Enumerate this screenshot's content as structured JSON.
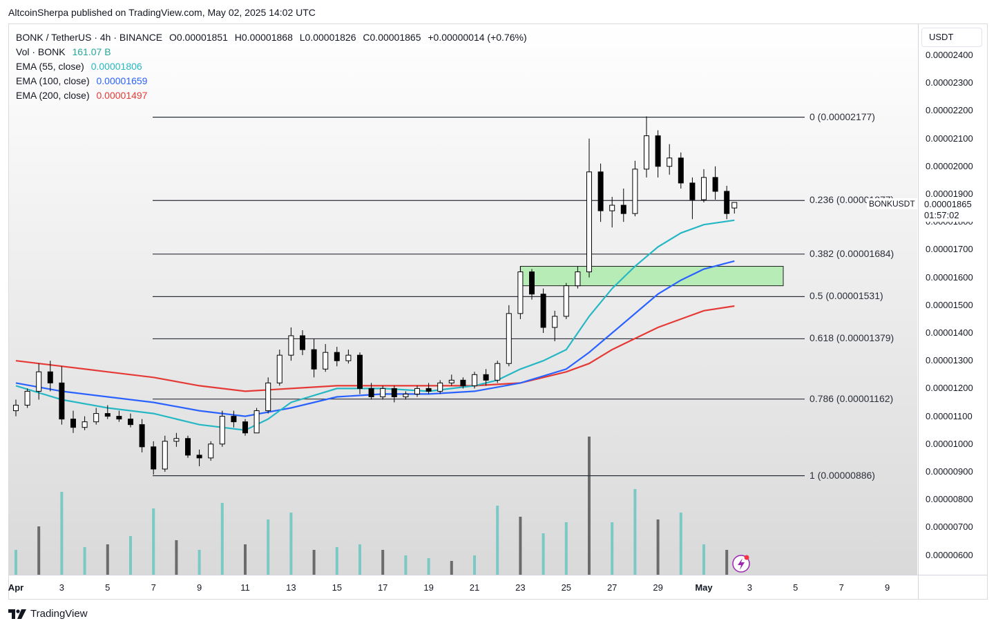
{
  "header": {
    "publisher_text": "AltcoinSherpa published on TradingView.com, May 02, 2025 14:02 UTC"
  },
  "legend": {
    "symbol_line": "BONK / TetherUS · 4h · BINANCE",
    "ohlc": {
      "open": "O0.00001851",
      "high": "H0.00001868",
      "low": "L0.00001826",
      "close": "C0.00001865",
      "change": "+0.00000014 (+0.76%)"
    },
    "vol_label": "Vol · BONK",
    "vol_value": "161.07 B",
    "ema55_label": "EMA (55, close)",
    "ema55_value": "0.00001806",
    "ema100_label": "EMA (100, close)",
    "ema100_value": "0.00001659",
    "ema200_label": "EMA (200, close)",
    "ema200_value": "0.00001497"
  },
  "currency_button": "USDT",
  "price_axis_labels": [
    "0.00002400",
    "0.00002300",
    "0.00002200",
    "0.00002100",
    "0.00002000",
    "0.00001900",
    "0.00001800",
    "0.00001700",
    "0.00001600",
    "0.00001500",
    "0.00001400",
    "0.00001300",
    "0.00001200",
    "0.00001100",
    "0.00001000",
    "0.00000900",
    "0.00000800",
    "0.00000700",
    "0.00000600"
  ],
  "time_axis_labels": [
    "Apr",
    "3",
    "5",
    "7",
    "9",
    "11",
    "13",
    "15",
    "17",
    "19",
    "21",
    "23",
    "25",
    "27",
    "29",
    "May",
    "3",
    "5",
    "7",
    "9"
  ],
  "current_price": {
    "symbol": "BONKUSDT",
    "price": "0.00001865",
    "countdown": "01:57:02"
  },
  "fib_levels": [
    {
      "label": "0 (0.00002177)",
      "price": 2.177e-05
    },
    {
      "label": "0.236 (0.00001877)",
      "price": 1.877e-05
    },
    {
      "label": "0.382 (0.00001684)",
      "price": 1.684e-05
    },
    {
      "label": "0.5 (0.00001531)",
      "price": 1.531e-05
    },
    {
      "label": "0.618 (0.00001379)",
      "price": 1.379e-05
    },
    {
      "label": "0.786 (0.00001162)",
      "price": 1.162e-05
    },
    {
      "label": "1 (0.00000886)",
      "price": 8.86e-06
    }
  ],
  "footer": {
    "brand": "TradingView"
  },
  "colors": {
    "ema55": "#26b7c5",
    "ema100": "#2962ff",
    "ema200": "#e53935",
    "zone_fill": "#b7ecb7",
    "vol_up": "#7ac9c5",
    "vol_down": "#6b6b6b",
    "candle_up": "#ffffff",
    "candle_down": "#000000"
  },
  "chart_data": {
    "type": "candlestick",
    "symbol": "BONKUSDT",
    "interval": "4h",
    "y_range": [
      5.5e-06,
      2.45e-05
    ],
    "x_start": "2025-04-01",
    "x_end": "2025-05-09",
    "support_zone": {
      "from": "2025-04-23",
      "to": "2025-05-04",
      "low": 1.57e-05,
      "high": 1.64e-05
    },
    "candles": [
      {
        "t": "2025-04-01T00",
        "o": 1.12e-05,
        "h": 1.16e-05,
        "l": 1.1e-05,
        "c": 1.14e-05
      },
      {
        "t": "2025-04-01T12",
        "o": 1.14e-05,
        "h": 1.2e-05,
        "l": 1.13e-05,
        "c": 1.19e-05
      },
      {
        "t": "2025-04-02T00",
        "o": 1.19e-05,
        "h": 1.29e-05,
        "l": 1.16e-05,
        "c": 1.26e-05
      },
      {
        "t": "2025-04-02T12",
        "o": 1.26e-05,
        "h": 1.3e-05,
        "l": 1.19e-05,
        "c": 1.22e-05
      },
      {
        "t": "2025-04-03T00",
        "o": 1.22e-05,
        "h": 1.28e-05,
        "l": 1.07e-05,
        "c": 1.09e-05
      },
      {
        "t": "2025-04-03T12",
        "o": 1.09e-05,
        "h": 1.12e-05,
        "l": 1.04e-05,
        "c": 1.06e-05
      },
      {
        "t": "2025-04-04T00",
        "o": 1.06e-05,
        "h": 1.1e-05,
        "l": 1.05e-05,
        "c": 1.08e-05
      },
      {
        "t": "2025-04-04T12",
        "o": 1.08e-05,
        "h": 1.13e-05,
        "l": 1.07e-05,
        "c": 1.11e-05
      },
      {
        "t": "2025-04-05T00",
        "o": 1.11e-05,
        "h": 1.14e-05,
        "l": 1.09e-05,
        "c": 1.1e-05
      },
      {
        "t": "2025-04-05T12",
        "o": 1.1e-05,
        "h": 1.12e-05,
        "l": 1.08e-05,
        "c": 1.09e-05
      },
      {
        "t": "2025-04-06T00",
        "o": 1.09e-05,
        "h": 1.11e-05,
        "l": 1.06e-05,
        "c": 1.07e-05
      },
      {
        "t": "2025-04-06T12",
        "o": 1.07e-05,
        "h": 1.09e-05,
        "l": 9.7e-06,
        "c": 9.9e-06
      },
      {
        "t": "2025-04-07T00",
        "o": 9.9e-06,
        "h": 1.01e-05,
        "l": 8.9e-06,
        "c": 9.1e-06
      },
      {
        "t": "2025-04-07T12",
        "o": 9.1e-06,
        "h": 1.03e-05,
        "l": 9e-06,
        "c": 1.01e-05
      },
      {
        "t": "2025-04-08T00",
        "o": 1.01e-05,
        "h": 1.04e-05,
        "l": 9.9e-06,
        "c": 1.02e-05
      },
      {
        "t": "2025-04-08T12",
        "o": 1.02e-05,
        "h": 1.03e-05,
        "l": 9.5e-06,
        "c": 9.6e-06
      },
      {
        "t": "2025-04-09T00",
        "o": 9.6e-06,
        "h": 9.8e-06,
        "l": 9.2e-06,
        "c": 9.5e-06
      },
      {
        "t": "2025-04-09T12",
        "o": 9.5e-06,
        "h": 1.01e-05,
        "l": 9.4e-06,
        "c": 1e-05
      },
      {
        "t": "2025-04-10T00",
        "o": 1e-05,
        "h": 1.12e-05,
        "l": 9.9e-06,
        "c": 1.1e-05
      },
      {
        "t": "2025-04-10T12",
        "o": 1.1e-05,
        "h": 1.12e-05,
        "l": 1.06e-05,
        "c": 1.08e-05
      },
      {
        "t": "2025-04-11T00",
        "o": 1.08e-05,
        "h": 1.09e-05,
        "l": 1.03e-05,
        "c": 1.04e-05
      },
      {
        "t": "2025-04-11T12",
        "o": 1.04e-05,
        "h": 1.13e-05,
        "l": 1.04e-05,
        "c": 1.12e-05
      },
      {
        "t": "2025-04-12T00",
        "o": 1.12e-05,
        "h": 1.24e-05,
        "l": 1.11e-05,
        "c": 1.22e-05
      },
      {
        "t": "2025-04-12T12",
        "o": 1.22e-05,
        "h": 1.34e-05,
        "l": 1.21e-05,
        "c": 1.32e-05
      },
      {
        "t": "2025-04-13T00",
        "o": 1.32e-05,
        "h": 1.42e-05,
        "l": 1.3e-05,
        "c": 1.39e-05
      },
      {
        "t": "2025-04-13T12",
        "o": 1.39e-05,
        "h": 1.41e-05,
        "l": 1.32e-05,
        "c": 1.34e-05
      },
      {
        "t": "2025-04-14T00",
        "o": 1.34e-05,
        "h": 1.38e-05,
        "l": 1.24e-05,
        "c": 1.27e-05
      },
      {
        "t": "2025-04-14T12",
        "o": 1.27e-05,
        "h": 1.36e-05,
        "l": 1.26e-05,
        "c": 1.33e-05
      },
      {
        "t": "2025-04-15T00",
        "o": 1.33e-05,
        "h": 1.35e-05,
        "l": 1.28e-05,
        "c": 1.3e-05
      },
      {
        "t": "2025-04-15T12",
        "o": 1.3e-05,
        "h": 1.34e-05,
        "l": 1.29e-05,
        "c": 1.32e-05
      },
      {
        "t": "2025-04-16T00",
        "o": 1.32e-05,
        "h": 1.33e-05,
        "l": 1.18e-05,
        "c": 1.2e-05
      },
      {
        "t": "2025-04-16T12",
        "o": 1.2e-05,
        "h": 1.22e-05,
        "l": 1.16e-05,
        "c": 1.17e-05
      },
      {
        "t": "2025-04-17T00",
        "o": 1.17e-05,
        "h": 1.21e-05,
        "l": 1.16e-05,
        "c": 1.2e-05
      },
      {
        "t": "2025-04-17T12",
        "o": 1.2e-05,
        "h": 1.21e-05,
        "l": 1.15e-05,
        "c": 1.17e-05
      },
      {
        "t": "2025-04-18T00",
        "o": 1.17e-05,
        "h": 1.19e-05,
        "l": 1.16e-05,
        "c": 1.18e-05
      },
      {
        "t": "2025-04-18T12",
        "o": 1.18e-05,
        "h": 1.21e-05,
        "l": 1.17e-05,
        "c": 1.2e-05
      },
      {
        "t": "2025-04-19T00",
        "o": 1.2e-05,
        "h": 1.22e-05,
        "l": 1.18e-05,
        "c": 1.19e-05
      },
      {
        "t": "2025-04-19T12",
        "o": 1.19e-05,
        "h": 1.23e-05,
        "l": 1.18e-05,
        "c": 1.22e-05
      },
      {
        "t": "2025-04-20T00",
        "o": 1.22e-05,
        "h": 1.25e-05,
        "l": 1.21e-05,
        "c": 1.23e-05
      },
      {
        "t": "2025-04-20T12",
        "o": 1.23e-05,
        "h": 1.24e-05,
        "l": 1.2e-05,
        "c": 1.21e-05
      },
      {
        "t": "2025-04-21T00",
        "o": 1.21e-05,
        "h": 1.26e-05,
        "l": 1.2e-05,
        "c": 1.25e-05
      },
      {
        "t": "2025-04-21T12",
        "o": 1.25e-05,
        "h": 1.27e-05,
        "l": 1.21e-05,
        "c": 1.23e-05
      },
      {
        "t": "2025-04-22T00",
        "o": 1.23e-05,
        "h": 1.3e-05,
        "l": 1.22e-05,
        "c": 1.29e-05
      },
      {
        "t": "2025-04-22T12",
        "o": 1.29e-05,
        "h": 1.5e-05,
        "l": 1.28e-05,
        "c": 1.47e-05
      },
      {
        "t": "2025-04-23T00",
        "o": 1.47e-05,
        "h": 1.64e-05,
        "l": 1.45e-05,
        "c": 1.62e-05
      },
      {
        "t": "2025-04-23T12",
        "o": 1.62e-05,
        "h": 1.63e-05,
        "l": 1.52e-05,
        "c": 1.54e-05
      },
      {
        "t": "2025-04-24T00",
        "o": 1.54e-05,
        "h": 1.56e-05,
        "l": 1.4e-05,
        "c": 1.42e-05
      },
      {
        "t": "2025-04-24T12",
        "o": 1.42e-05,
        "h": 1.48e-05,
        "l": 1.37e-05,
        "c": 1.46e-05
      },
      {
        "t": "2025-04-25T00",
        "o": 1.46e-05,
        "h": 1.58e-05,
        "l": 1.45e-05,
        "c": 1.57e-05
      },
      {
        "t": "2025-04-25T12",
        "o": 1.57e-05,
        "h": 1.64e-05,
        "l": 1.56e-05,
        "c": 1.62e-05
      },
      {
        "t": "2025-04-26T00",
        "o": 1.62e-05,
        "h": 2.1e-05,
        "l": 1.6e-05,
        "c": 1.98e-05
      },
      {
        "t": "2025-04-26T12",
        "o": 1.98e-05,
        "h": 2.01e-05,
        "l": 1.8e-05,
        "c": 1.84e-05
      },
      {
        "t": "2025-04-27T00",
        "o": 1.84e-05,
        "h": 1.89e-05,
        "l": 1.78e-05,
        "c": 1.86e-05
      },
      {
        "t": "2025-04-27T12",
        "o": 1.86e-05,
        "h": 1.92e-05,
        "l": 1.8e-05,
        "c": 1.83e-05
      },
      {
        "t": "2025-04-28T00",
        "o": 1.83e-05,
        "h": 2.02e-05,
        "l": 1.82e-05,
        "c": 1.99e-05
      },
      {
        "t": "2025-04-28T12",
        "o": 1.99e-05,
        "h": 2.18e-05,
        "l": 1.96e-05,
        "c": 2.11e-05
      },
      {
        "t": "2025-04-29T00",
        "o": 2.11e-05,
        "h": 2.13e-05,
        "l": 1.96e-05,
        "c": 2e-05
      },
      {
        "t": "2025-04-29T12",
        "o": 2e-05,
        "h": 2.08e-05,
        "l": 1.97e-05,
        "c": 2.03e-05
      },
      {
        "t": "2025-04-30T00",
        "o": 2.03e-05,
        "h": 2.05e-05,
        "l": 1.92e-05,
        "c": 1.94e-05
      },
      {
        "t": "2025-04-30T12",
        "o": 1.94e-05,
        "h": 1.96e-05,
        "l": 1.81e-05,
        "c": 1.88e-05
      },
      {
        "t": "2025-05-01T00",
        "o": 1.88e-05,
        "h": 1.99e-05,
        "l": 1.87e-05,
        "c": 1.96e-05
      },
      {
        "t": "2025-05-01T12",
        "o": 1.96e-05,
        "h": 2e-05,
        "l": 1.88e-05,
        "c": 1.91e-05
      },
      {
        "t": "2025-05-02T00",
        "o": 1.91e-05,
        "h": 1.93e-05,
        "l": 1.81e-05,
        "c": 1.83e-05
      },
      {
        "t": "2025-05-02T08",
        "o": 1.85e-05,
        "h": 1.87e-05,
        "l": 1.83e-05,
        "c": 1.87e-05
      }
    ],
    "ema55": [
      {
        "t": "2025-04-01",
        "v": 1.21e-05
      },
      {
        "t": "2025-04-03",
        "v": 1.16e-05
      },
      {
        "t": "2025-04-05",
        "v": 1.13e-05
      },
      {
        "t": "2025-04-07",
        "v": 1.11e-05
      },
      {
        "t": "2025-04-09",
        "v": 1.07e-05
      },
      {
        "t": "2025-04-11",
        "v": 1.05e-05
      },
      {
        "t": "2025-04-12",
        "v": 1.09e-05
      },
      {
        "t": "2025-04-13",
        "v": 1.15e-05
      },
      {
        "t": "2025-04-15",
        "v": 1.2e-05
      },
      {
        "t": "2025-04-17",
        "v": 1.2e-05
      },
      {
        "t": "2025-04-19",
        "v": 1.19e-05
      },
      {
        "t": "2025-04-21",
        "v": 1.21e-05
      },
      {
        "t": "2025-04-22",
        "v": 1.23e-05
      },
      {
        "t": "2025-04-23",
        "v": 1.27e-05
      },
      {
        "t": "2025-04-24",
        "v": 1.3e-05
      },
      {
        "t": "2025-04-25",
        "v": 1.34e-05
      },
      {
        "t": "2025-04-26",
        "v": 1.46e-05
      },
      {
        "t": "2025-04-27",
        "v": 1.56e-05
      },
      {
        "t": "2025-04-28",
        "v": 1.64e-05
      },
      {
        "t": "2025-04-29",
        "v": 1.71e-05
      },
      {
        "t": "2025-04-30",
        "v": 1.76e-05
      },
      {
        "t": "2025-05-01",
        "v": 1.79e-05
      },
      {
        "t": "2025-05-02T08",
        "v": 1.806e-05
      }
    ],
    "ema100": [
      {
        "t": "2025-04-01",
        "v": 1.22e-05
      },
      {
        "t": "2025-04-03",
        "v": 1.19e-05
      },
      {
        "t": "2025-04-05",
        "v": 1.17e-05
      },
      {
        "t": "2025-04-07",
        "v": 1.15e-05
      },
      {
        "t": "2025-04-09",
        "v": 1.12e-05
      },
      {
        "t": "2025-04-11",
        "v": 1.1e-05
      },
      {
        "t": "2025-04-13",
        "v": 1.13e-05
      },
      {
        "t": "2025-04-15",
        "v": 1.17e-05
      },
      {
        "t": "2025-04-17",
        "v": 1.18e-05
      },
      {
        "t": "2025-04-19",
        "v": 1.18e-05
      },
      {
        "t": "2025-04-21",
        "v": 1.19e-05
      },
      {
        "t": "2025-04-23",
        "v": 1.22e-05
      },
      {
        "t": "2025-04-25",
        "v": 1.27e-05
      },
      {
        "t": "2025-04-26",
        "v": 1.33e-05
      },
      {
        "t": "2025-04-27",
        "v": 1.4e-05
      },
      {
        "t": "2025-04-28",
        "v": 1.47e-05
      },
      {
        "t": "2025-04-29",
        "v": 1.54e-05
      },
      {
        "t": "2025-04-30",
        "v": 1.59e-05
      },
      {
        "t": "2025-05-01",
        "v": 1.63e-05
      },
      {
        "t": "2025-05-02T08",
        "v": 1.659e-05
      }
    ],
    "ema200": [
      {
        "t": "2025-04-01",
        "v": 1.3e-05
      },
      {
        "t": "2025-04-03",
        "v": 1.28e-05
      },
      {
        "t": "2025-04-05",
        "v": 1.26e-05
      },
      {
        "t": "2025-04-07",
        "v": 1.24e-05
      },
      {
        "t": "2025-04-09",
        "v": 1.21e-05
      },
      {
        "t": "2025-04-11",
        "v": 1.19e-05
      },
      {
        "t": "2025-04-13",
        "v": 1.2e-05
      },
      {
        "t": "2025-04-15",
        "v": 1.21e-05
      },
      {
        "t": "2025-04-17",
        "v": 1.21e-05
      },
      {
        "t": "2025-04-19",
        "v": 1.21e-05
      },
      {
        "t": "2025-04-21",
        "v": 1.21e-05
      },
      {
        "t": "2025-04-23",
        "v": 1.22e-05
      },
      {
        "t": "2025-04-25",
        "v": 1.26e-05
      },
      {
        "t": "2025-04-26",
        "v": 1.29e-05
      },
      {
        "t": "2025-04-27",
        "v": 1.34e-05
      },
      {
        "t": "2025-04-28",
        "v": 1.38e-05
      },
      {
        "t": "2025-04-29",
        "v": 1.42e-05
      },
      {
        "t": "2025-04-30",
        "v": 1.45e-05
      },
      {
        "t": "2025-05-01",
        "v": 1.48e-05
      },
      {
        "t": "2025-05-02T08",
        "v": 1.497e-05
      }
    ],
    "volume": [
      {
        "t": "2025-04-01",
        "v": 18
      },
      {
        "t": "2025-04-02",
        "v": 35
      },
      {
        "t": "2025-04-03",
        "v": 60
      },
      {
        "t": "2025-04-04",
        "v": 20
      },
      {
        "t": "2025-04-05",
        "v": 22
      },
      {
        "t": "2025-04-06",
        "v": 28
      },
      {
        "t": "2025-04-07",
        "v": 48
      },
      {
        "t": "2025-04-08",
        "v": 25
      },
      {
        "t": "2025-04-09",
        "v": 18
      },
      {
        "t": "2025-04-10",
        "v": 52
      },
      {
        "t": "2025-04-11",
        "v": 22
      },
      {
        "t": "2025-04-12",
        "v": 40
      },
      {
        "t": "2025-04-13",
        "v": 45
      },
      {
        "t": "2025-04-14",
        "v": 18
      },
      {
        "t": "2025-04-15",
        "v": 20
      },
      {
        "t": "2025-04-16",
        "v": 22
      },
      {
        "t": "2025-04-17",
        "v": 18
      },
      {
        "t": "2025-04-18",
        "v": 14
      },
      {
        "t": "2025-04-19",
        "v": 12
      },
      {
        "t": "2025-04-20",
        "v": 10
      },
      {
        "t": "2025-04-21",
        "v": 14
      },
      {
        "t": "2025-04-22",
        "v": 50
      },
      {
        "t": "2025-04-23",
        "v": 42
      },
      {
        "t": "2025-04-24",
        "v": 30
      },
      {
        "t": "2025-04-25",
        "v": 38
      },
      {
        "t": "2025-04-26",
        "v": 100
      },
      {
        "t": "2025-04-27",
        "v": 38
      },
      {
        "t": "2025-04-28",
        "v": 62
      },
      {
        "t": "2025-04-29",
        "v": 40
      },
      {
        "t": "2025-04-30",
        "v": 45
      },
      {
        "t": "2025-05-01",
        "v": 22
      },
      {
        "t": "2025-05-02",
        "v": 18
      }
    ]
  }
}
